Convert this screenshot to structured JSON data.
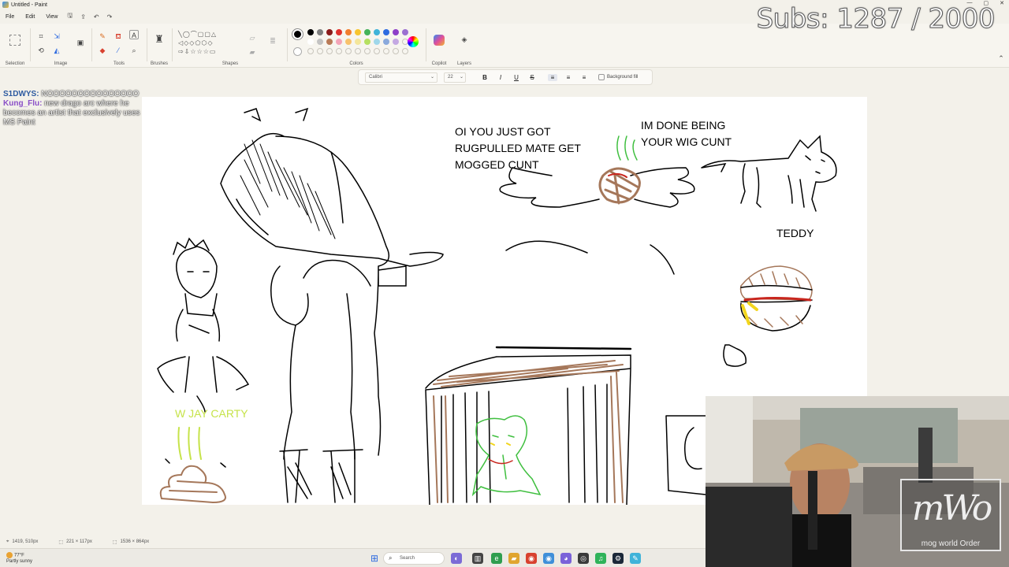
{
  "window": {
    "title": "Untitled - Paint",
    "controls": [
      "—",
      "▢",
      "✕"
    ]
  },
  "menu": {
    "file": "File",
    "edit": "Edit",
    "view": "View"
  },
  "ribbon": {
    "groups": {
      "selection": "Selection",
      "image": "Image",
      "tools": "Tools",
      "brushes": "Brushes",
      "shapes": "Shapes",
      "colors": "Colors",
      "copilot": "Copilot",
      "layers": "Layers"
    },
    "palette_row1": [
      "#000000",
      "#7f7f7f",
      "#8b1a1a",
      "#e0312d",
      "#f17e2e",
      "#f7c52f",
      "#44b35a",
      "#3fb3d9",
      "#2f6be0",
      "#8e3fc8",
      "#9c6fd1"
    ],
    "palette_row2": [
      "#ffffff",
      "#c3c3c3",
      "#b97a57",
      "#f4a4b8",
      "#f8c26c",
      "#f4e69a",
      "#b5e061",
      "#9fd7ea",
      "#8aa9dc",
      "#c4a8e2"
    ]
  },
  "textbar": {
    "font": "Calibri",
    "size": "22",
    "bold": "B",
    "italic": "I",
    "underline": "U",
    "strike": "S",
    "align_left": "≡",
    "align_center": "≡",
    "align_right": "≡",
    "background_fill": "Background fill"
  },
  "chat": [
    {
      "user": "S1DWYS:",
      "message": "NOOOOOOOOOOOOOOO"
    },
    {
      "user": "Kung_Flu:",
      "message": "new drago arc where he becomes an artist that exclusively uses MS Paint"
    }
  ],
  "subs": {
    "label": "Subs: 1287 / 2000",
    "current": 1287,
    "goal": 2000
  },
  "canvas": {
    "texts": {
      "rugpull": [
        "OI YOU JUST GOT",
        "RUGPULLED MATE GET",
        "MOGGED CUNT"
      ],
      "wig": [
        "IM DONE BEING",
        "YOUR WIG CUNT"
      ],
      "teddy": "TEDDY",
      "carty": "W JAY CARTY"
    },
    "colors": {
      "ink": "#000000",
      "brown": "#a5775a",
      "green": "#3fbf3f",
      "yellow_green": "#c6e34a",
      "red": "#c8261e",
      "yellow": "#f2d51d"
    }
  },
  "statusbar": {
    "cursor": "1419, 510px",
    "selection": "221 × 117px",
    "canvas_size": "1536 × 864px"
  },
  "webcam": {
    "logo_mark": "mWo",
    "logo_caption": "mog world Order"
  },
  "taskbar": {
    "weather_temp": "77°F",
    "weather_desc": "Partly sunny",
    "search": "Search"
  }
}
